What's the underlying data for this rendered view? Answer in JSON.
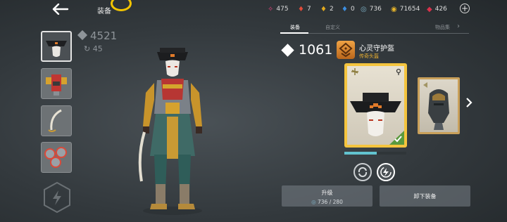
{
  "header": {
    "title": "装备",
    "resources": [
      {
        "name": "pink-gem",
        "value": "475",
        "color": "#e0417a",
        "glyph": "✧"
      },
      {
        "name": "red-gem",
        "value": "7",
        "color": "#e04b3a",
        "glyph": "♦"
      },
      {
        "name": "gold-gem",
        "value": "2",
        "color": "#e2a91d",
        "glyph": "♦"
      },
      {
        "name": "blue-gem",
        "value": "0",
        "color": "#3c8ee0",
        "glyph": "♦"
      },
      {
        "name": "shadow-orb",
        "value": "736",
        "color": "#7fb2c7",
        "glyph": "◎"
      },
      {
        "name": "coin",
        "value": "71654",
        "color": "#e6b42a",
        "glyph": "◉"
      },
      {
        "name": "ruby",
        "value": "426",
        "color": "#d8324b",
        "glyph": "◆"
      }
    ]
  },
  "character": {
    "power": "4521",
    "level": "45"
  },
  "tabs": [
    {
      "label": "装备"
    },
    {
      "label": "自定义"
    },
    {
      "label": "物品集"
    }
  ],
  "item": {
    "power": "1061",
    "name": "心灵守护盔",
    "rarity": "传奇头盔",
    "rarity_color": "#f1b430",
    "upgrade_progress": 0.52
  },
  "buttons": {
    "upgrade_label": "升级",
    "upgrade_cost": "736 / 280",
    "unequip_label": "卸下装备"
  },
  "colors": {
    "accent": "#62c3cf",
    "legendary": "#f4c43e",
    "equipped_check": "#5a9a3e"
  }
}
